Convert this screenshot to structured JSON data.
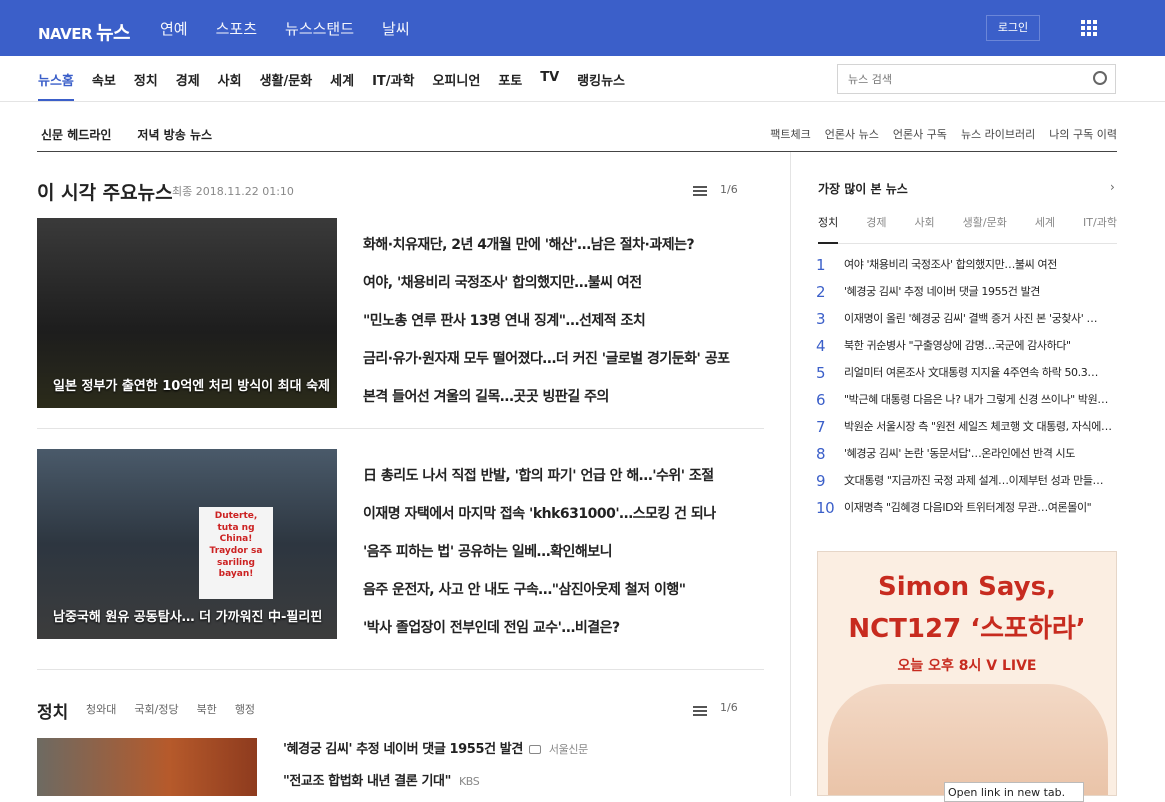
{
  "header": {
    "logo": "NAVER",
    "logo_news": "뉴스",
    "nav": [
      "연예",
      "스포츠",
      "뉴스스탠드",
      "날씨"
    ],
    "login": "로그인"
  },
  "categories": [
    "뉴스홈",
    "속보",
    "정치",
    "경제",
    "사회",
    "생활/문화",
    "세계",
    "IT/과학",
    "오피니언",
    "포토",
    "TV",
    "랭킹뉴스"
  ],
  "search": {
    "placeholder": "뉴스 검색"
  },
  "subbar": {
    "left": [
      "신문 헤드라인",
      "저녁 방송 뉴스"
    ],
    "right": [
      "팩트체크",
      "언론사 뉴스",
      "언론사 구독",
      "뉴스 라이브러리",
      "나의 구독 이력"
    ]
  },
  "main": {
    "title": "이 시각 주요뉴스",
    "updated": "최종 2018.11.22 01:10",
    "pager": "1/6",
    "box1": {
      "caption": "일본 정부가 출연한 10억엔 처리 방식이 최대 숙제",
      "headlines": [
        "화해·치유재단, 2년 4개월 만에 '해산'…남은 절차·과제는?",
        "여야, '채용비리 국정조사' 합의했지만…불씨 여전",
        "\"민노총 연루 판사 13명 연내 징계\"…선제적 조치",
        "금리·유가·원자재 모두 떨어졌다…더 커진 '글로벌 경기둔화' 공포",
        "본격 들어선 겨울의 길목…곳곳 빙판길 주의"
      ]
    },
    "box2": {
      "caption": "남중국해 원유 공동탐사… 더 가까워진 中-필리핀",
      "sign_text": "Duterte, tuta ng China! Traydor sa sariling bayan!",
      "headlines": [
        "日 총리도 나서 직접 반발, '합의 파기' 언급 안 해…'수위' 조절",
        "이재명 자택에서 마지막 접속 'khk631000'…스모킹 건 되나",
        "'음주 피하는 법' 공유하는 일베…확인해보니",
        "음주 운전자, 사고 안 내도 구속…\"삼진아웃제 철저 이행\"",
        "'박사 졸업장이 전부인데 전임 교수'…비결은?"
      ]
    }
  },
  "side": {
    "title": "가장 많이 본 뉴스",
    "more": "›",
    "tabs": [
      "정치",
      "경제",
      "사회",
      "생활/문화",
      "세계",
      "IT/과학"
    ],
    "ranking": [
      {
        "n": "1",
        "t": "여야 '채용비리 국정조사' 합의했지만…불씨 여전"
      },
      {
        "n": "2",
        "t": "'혜경궁 김씨' 추정 네이버 댓글 1955건 발견"
      },
      {
        "n": "3",
        "t": "이재명이 올린 '혜경궁 김씨' 결백 증거 사진 본 '궁찾사' …"
      },
      {
        "n": "4",
        "t": "북한 귀순병사 \"구출영상에 감명…국군에 감사하다\""
      },
      {
        "n": "5",
        "t": "리얼미터 여론조사 文대통령 지지율 4주연속 하락 50.3…"
      },
      {
        "n": "6",
        "t": "\"박근혜 대통령 다음은 나? 내가 그렇게 신경 쓰이나\" 박원순, 야…"
      },
      {
        "n": "7",
        "t": "박원순 서울시장 측 \"원전 세일즈 체코행 文 대통령, 자식에겐 과자 안…"
      },
      {
        "n": "8",
        "t": "'혜경궁 김씨' 논란 '동문서답'…온라인에선 반격 시도"
      },
      {
        "n": "9",
        "t": "文대통령 \"지금까진 국정 과제 설계…이제부턴 성과 만들…"
      },
      {
        "n": "10",
        "t": "이재명측 \"김혜경 다음ID와 트위터계정 무관…여론몰이\""
      }
    ]
  },
  "ad": {
    "line1": "Simon Says,",
    "line2": "NCT127 ‘스포하라’",
    "line3": "오늘 오후 8시 V LIVE"
  },
  "section2": {
    "title": "정치",
    "tabs": [
      "청와대",
      "국회/정당",
      "북한",
      "행정"
    ],
    "pager": "1/6",
    "items": [
      {
        "t": "'혜경궁 김씨' 추정 네이버 댓글 1955건 발견",
        "src": "서울신문"
      },
      {
        "t": "\"전교조 합법화 내년 결론 기대\"",
        "src": "KBS"
      }
    ]
  },
  "tooltip": "Open link in new tab."
}
